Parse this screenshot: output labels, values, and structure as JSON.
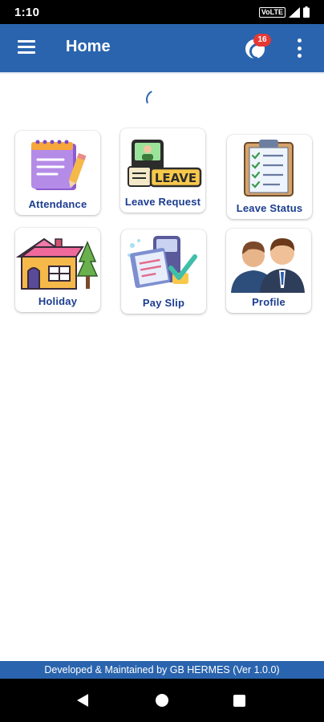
{
  "status_bar": {
    "time": "1:10",
    "network_label": "VoLTE",
    "icons": [
      "volte-icon",
      "signal-icon",
      "battery-icon"
    ]
  },
  "app_bar": {
    "title": "Home",
    "menu_icon": "hamburger-menu-icon",
    "notification_icon": "notification-icon",
    "notification_count": "16",
    "more_icon": "more-vertical-icon",
    "background_color": "#2a64ae"
  },
  "loading_indicator": "spinner-icon",
  "tiles": [
    {
      "label": "Attendance",
      "icon": "notepad-icon"
    },
    {
      "label": "Leave Request",
      "icon": "leave-request-icon"
    },
    {
      "label": "Leave Status",
      "icon": "clipboard-checklist-icon"
    },
    {
      "label": "Holiday",
      "icon": "house-icon"
    },
    {
      "label": "Pay Slip",
      "icon": "payslip-icon"
    },
    {
      "label": "Profile",
      "icon": "people-icon"
    }
  ],
  "footer": {
    "text": "Developed & Maintained by GB HERMES (Ver 1.0.0)"
  },
  "nav_bar": {
    "back_icon": "back-icon",
    "home_icon": "home-icon",
    "recents_icon": "recents-icon"
  },
  "colors": {
    "primary": "#2a64ae",
    "label_text": "#1b3d8f",
    "badge": "#e53935"
  }
}
